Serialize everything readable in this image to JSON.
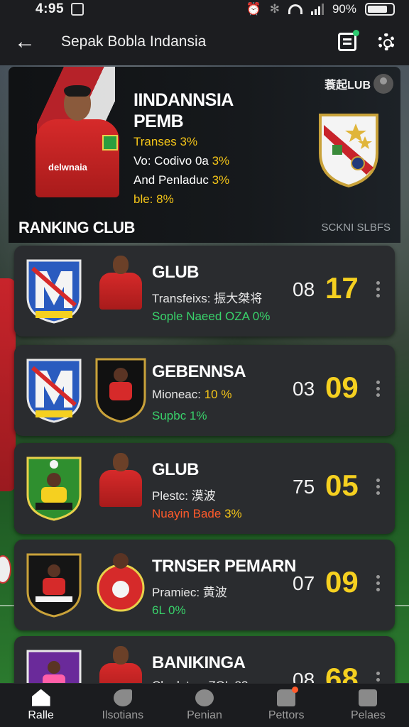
{
  "status": {
    "time": "4:95",
    "battery": "90%"
  },
  "appbar": {
    "title": "Sepak Bobla Indansia"
  },
  "hero": {
    "title1": "IINDANNSIA",
    "title2": "PEMB",
    "jersey_text": "delwnaia",
    "line1": "Transes 3%",
    "line2_a": "Vo: Codivo 0a ",
    "line2_b": "3%",
    "line3_a": "And Penladuc ",
    "line3_b": "3%",
    "line4": "ble: 8%",
    "brand": "蓑起LUB",
    "section": "RANKING CLUB",
    "tag": "SCKNI SLBFS"
  },
  "cards": [
    {
      "name": "GLUB",
      "line1": "Transfeixs: 振大桀将",
      "line2": "Sople Naeed OZA 0%",
      "line2_color": "green",
      "rank": "08",
      "score": "17"
    },
    {
      "name": "GEBENNSA",
      "line1_a": "Mioneac: ",
      "line1_b": "10 %",
      "line2": "Supbc 1%",
      "line2_color": "green",
      "rank": "03",
      "score": "09"
    },
    {
      "name": "GLUB",
      "line1": "Plestc: 漠波",
      "line2_a": "Nuayin Bade ",
      "line2_b": "3%",
      "line2_color": "orange",
      "rank": "75",
      "score": "05"
    },
    {
      "name": "TRNSER PEMARN",
      "line1": "Pramiec: 黄波",
      "line2": "6L 0%",
      "line2_color": "green",
      "rank": "07",
      "score": "09"
    },
    {
      "name": "BANIKINGA",
      "line1": "Claolatvy: ZOL 83",
      "line2": "",
      "line2_color": "green",
      "rank": "08",
      "score": "68"
    }
  ],
  "nav": [
    {
      "label": "Ralle",
      "icon": "home-icon",
      "active": true
    },
    {
      "label": "Ilsotians",
      "icon": "bird-icon",
      "active": false
    },
    {
      "label": "Penian",
      "icon": "spotify-icon",
      "active": false
    },
    {
      "label": "Pettors",
      "icon": "pets-icon",
      "active": false
    },
    {
      "label": "Pelaes",
      "icon": "bag-icon",
      "active": false
    }
  ],
  "colors": {
    "accent_yellow": "#f5d020",
    "green": "#39d36b",
    "orange": "#ff5a2b",
    "card": "#2a2c2f"
  }
}
